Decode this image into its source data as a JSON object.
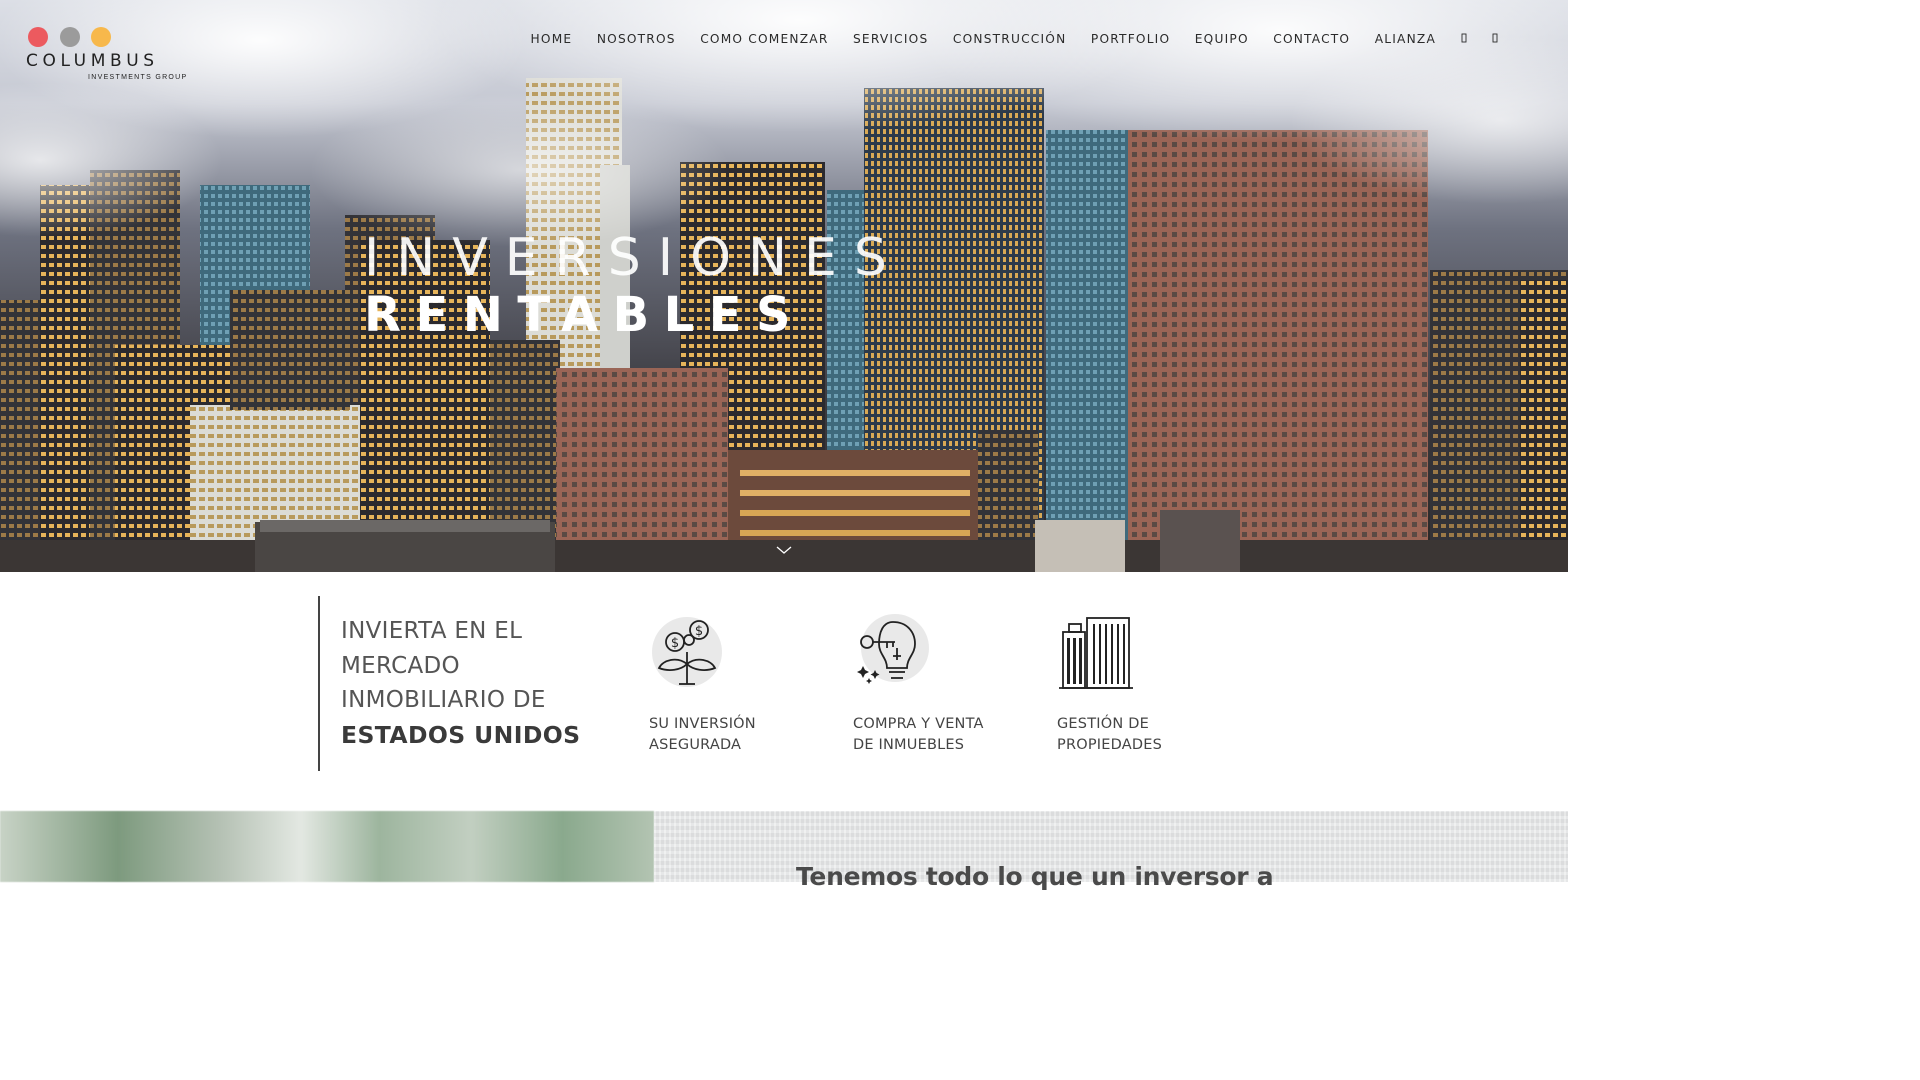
{
  "brand": {
    "name": "COLUMBUS",
    "tagline": "INVESTMENTS GROUP",
    "dot_colors": [
      "#ec5a5f",
      "#9b9b9b",
      "#f7b84b"
    ]
  },
  "nav": {
    "items": [
      "HOME",
      "NOSOTROS",
      "COMO COMENZAR",
      "SERVICIOS",
      "CONSTRUCCIÓN",
      "PORTFOLIO",
      "EQUIPO",
      "CONTACTO",
      "ALIANZA"
    ],
    "icons": [
      "search-icon",
      "cart-icon"
    ]
  },
  "hero": {
    "line1": "INVERSIONES",
    "line2": "RENTABLES"
  },
  "intro": {
    "lines": [
      "INVIERTA EN EL",
      "MERCADO",
      "INMOBILIARIO DE"
    ],
    "strong": "ESTADOS UNIDOS"
  },
  "features": [
    {
      "label": "SU INVERSIÓN\nASEGURADA",
      "icon": "money-plant-icon"
    },
    {
      "label": "COMPRA Y VENTA\nDE INMUEBLES",
      "icon": "key-bulb-icon"
    },
    {
      "label": "GESTIÓN DE\nPROPIEDADES",
      "icon": "buildings-icon"
    }
  ],
  "bottom": {
    "heading": "Tenemos todo lo que un inversor a"
  }
}
